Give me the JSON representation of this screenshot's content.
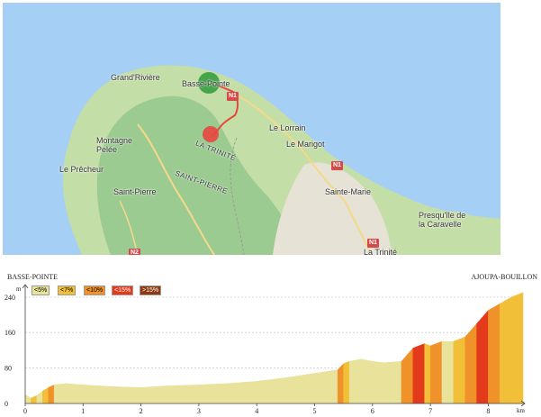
{
  "map": {
    "places": [
      {
        "key": "grand_riviere",
        "label": "Grand'Rivière"
      },
      {
        "key": "basse_pointe",
        "label": "Basse-Pointe"
      },
      {
        "key": "montagne_pelee",
        "label": "Montagne\nPelée"
      },
      {
        "key": "le_lorrain",
        "label": "Le Lorrain"
      },
      {
        "key": "le_marigot",
        "label": "Le Marigot"
      },
      {
        "key": "le_precheur",
        "label": "Le Prêcheur"
      },
      {
        "key": "saint_pierre_town",
        "label": "Saint-Pierre"
      },
      {
        "key": "sainte_marie",
        "label": "Sainte-Marie"
      },
      {
        "key": "caravelle",
        "label": "Presqu'île de\nla Caravelle"
      },
      {
        "key": "la_trinite",
        "label": "La Trinité"
      },
      {
        "key": "la_trinite_region",
        "label": "LA TRINITÉ"
      },
      {
        "key": "saint_pierre_region",
        "label": "SAINT-PIERRE"
      }
    ],
    "road_signs": [
      "N1",
      "N1",
      "N1",
      "N2"
    ],
    "start_color": "#2e9b3a",
    "end_color": "#e8473f",
    "route_color": "#e8473f"
  },
  "profile": {
    "start_label": "BASSE-POINTE",
    "end_label": "AJOUPA-BOUILLON",
    "y_unit": "m",
    "x_unit": "km",
    "y_ticks": [
      "0",
      "80",
      "160",
      "240"
    ],
    "x_ticks": [
      "0",
      "1",
      "2",
      "3",
      "4",
      "5",
      "6",
      "7",
      "8"
    ],
    "legend": [
      {
        "label": "<5%",
        "color": "#e8e29a"
      },
      {
        "label": "<7%",
        "color": "#f2c038"
      },
      {
        "label": "<10%",
        "color": "#f0922a"
      },
      {
        "label": "<15%",
        "color": "#e33a1c"
      },
      {
        "label": ">15%",
        "color": "#8b3a12"
      }
    ]
  },
  "chart_data": {
    "type": "area",
    "xlabel": "km",
    "ylabel": "m",
    "xlim": [
      0,
      8.6
    ],
    "ylim": [
      0,
      260
    ],
    "x": [
      0,
      0.1,
      0.2,
      0.3,
      0.4,
      0.5,
      0.7,
      1.0,
      1.5,
      2.0,
      2.5,
      3.0,
      3.5,
      4.0,
      4.5,
      5.0,
      5.4,
      5.5,
      5.6,
      5.8,
      6.0,
      6.2,
      6.5,
      6.7,
      6.9,
      7.0,
      7.2,
      7.4,
      7.6,
      7.8,
      8.0,
      8.2,
      8.4,
      8.6
    ],
    "y": [
      20,
      12,
      18,
      28,
      36,
      42,
      45,
      42,
      38,
      36,
      40,
      42,
      45,
      50,
      58,
      68,
      76,
      90,
      95,
      100,
      95,
      92,
      95,
      125,
      135,
      130,
      140,
      140,
      150,
      180,
      210,
      225,
      240,
      250
    ],
    "grade_classes": [
      "<5%",
      "<7%",
      "<5%",
      "<7%",
      "<10%",
      "<5%",
      "<5%",
      "<5%",
      "<5%",
      "<5%",
      "<5%",
      "<5%",
      "<5%",
      "<5%",
      "<5%",
      "<5%",
      "<10%",
      "<7%",
      "<5%",
      "<5%",
      "<5%",
      "<5%",
      "<10%",
      "<15%",
      "<7%",
      "<10%",
      "<5%",
      "<7%",
      "<10%",
      "<15%",
      "<10%",
      "<7%",
      "<7%"
    ]
  }
}
